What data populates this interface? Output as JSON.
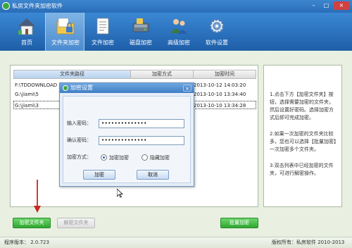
{
  "app": {
    "title": "私房文件夹加密软件",
    "window_buttons": {
      "minimize": "–",
      "maximize": "□",
      "close": "×"
    }
  },
  "toolbar": {
    "items": [
      {
        "label": "首页",
        "icon": "house-icon"
      },
      {
        "label": "文件夹加密",
        "icon": "folder-lock-icon",
        "active": true
      },
      {
        "label": "文件加密",
        "icon": "document-icon"
      },
      {
        "label": "磁盘加密",
        "icon": "disk-icon"
      },
      {
        "label": "高级加密",
        "icon": "users-icon"
      },
      {
        "label": "软件设置",
        "icon": "gear-icon"
      }
    ]
  },
  "table": {
    "columns": [
      "文件夹路径",
      "加密方式",
      "加密时间"
    ],
    "rows": [
      {
        "path": "F:\\TDDOWNLOAD",
        "method": "",
        "time": "2013-10-12 14:03:20"
      },
      {
        "path": "G:\\jiami\\5",
        "method": "",
        "time": "2013-10-10 13:34:40"
      },
      {
        "path": "G:\\jiami\\3",
        "method": "",
        "time": "2013-10-10 13:34:28"
      }
    ]
  },
  "tips": [
    "1.点击下方【加密文件夹】按钮，选择需要加密的文件夹，然后设置好密码。选择加密方式后即可完成加密。",
    "2.如果一次加密的文件夹比较多，您也可以选择【批量加密】一次加密多个文件夹。",
    "3.双击列表中已经加密的文件夹，可进行解密操作。"
  ],
  "dialog": {
    "title": "加密设置",
    "close": "×",
    "password_label": "输入密码：",
    "password_value": "••••••••••••••",
    "confirm_label": "确认密码：",
    "confirm_value": "••••••••••••••",
    "method_label": "加密方式：",
    "method_options": [
      {
        "label": "加密加密",
        "checked": true
      },
      {
        "label": "隐藏加密",
        "checked": false
      }
    ],
    "ok_label": "加密",
    "cancel_label": "取消"
  },
  "buttons": {
    "encrypt_folder": "加密文件夹",
    "decrypt_folder": "解密文件夹",
    "batch_encrypt": "批量加密"
  },
  "status": {
    "version": "程序版本：  2.0.723",
    "copyright": "版权所有：私房软件 2010-2013"
  },
  "colors": {
    "toolbar_blue": "#1e5ea8",
    "green_button": "#2fa82f",
    "annotation_arrow": "#c8281e"
  }
}
